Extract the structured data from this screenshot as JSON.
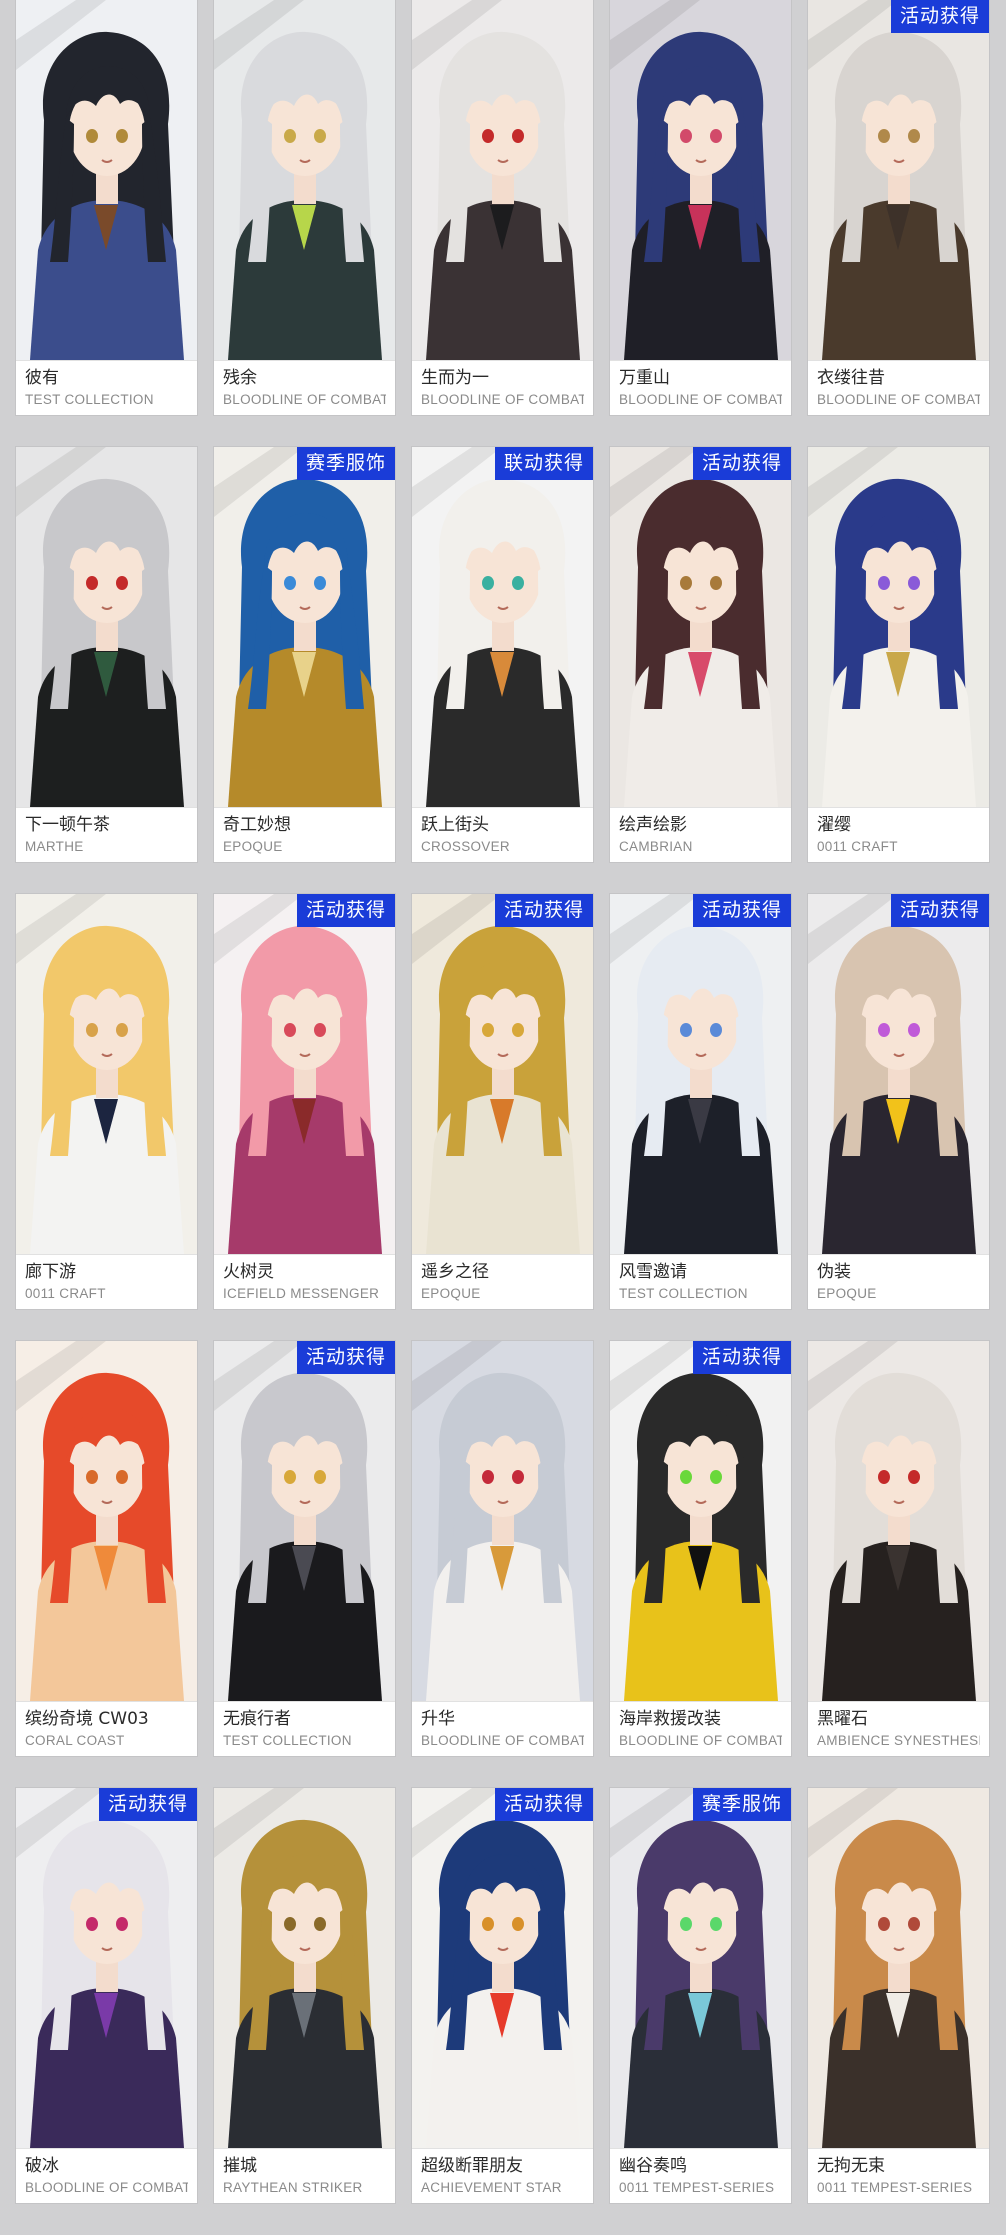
{
  "cards": [
    {
      "name": "彼有",
      "series": "TEST COLLECTION",
      "badge": "",
      "hair": "#22252d",
      "outfit": "#3b4d8c",
      "bg": "#eef0f3",
      "eyes": "#b08a3a",
      "accent": "#7a4a2a"
    },
    {
      "name": "残余",
      "series": "BLOODLINE OF COMBAT",
      "badge": "",
      "hair": "#d9dadd",
      "outfit": "#2c3a3a",
      "bg": "#e7e9ea",
      "eyes": "#c9a94a",
      "accent": "#b7d64a"
    },
    {
      "name": "生而为一",
      "series": "BLOODLINE OF COMBAT",
      "badge": "",
      "hair": "#e4e2e0",
      "outfit": "#3a3234",
      "bg": "#eceaea",
      "eyes": "#c42a2a",
      "accent": "#1c1c1e"
    },
    {
      "name": "万重山",
      "series": "BLOODLINE OF COMBAT",
      "badge": "",
      "hair": "#2d3a78",
      "outfit": "#1f1f27",
      "bg": "#d8d6dc",
      "eyes": "#d24a6a",
      "accent": "#c8325a"
    },
    {
      "name": "衣缕往昔",
      "series": "BLOODLINE OF COMBAT",
      "badge": "活动获得",
      "hair": "#d8d4d0",
      "outfit": "#4a3a2c",
      "bg": "#e9e6e2",
      "eyes": "#b0894a",
      "accent": "#3d3129"
    },
    {
      "name": "下一顿午茶",
      "series": "MARTHE",
      "badge": "",
      "hair": "#c8c8cb",
      "outfit": "#1d1f1f",
      "bg": "#e6e6e7",
      "eyes": "#c42a2a",
      "accent": "#2f5a3e"
    },
    {
      "name": "奇工妙想",
      "series": "EPOQUE",
      "badge": "赛季服饰",
      "hair": "#1f5fa8",
      "outfit": "#b58a2a",
      "bg": "#f1efea",
      "eyes": "#3a8ad8",
      "accent": "#e8d28a"
    },
    {
      "name": "跃上街头",
      "series": "CROSSOVER",
      "badge": "联动获得",
      "hair": "#f2f0ec",
      "outfit": "#2a2a2a",
      "bg": "#f3f3f3",
      "eyes": "#3ab0a0",
      "accent": "#d88a3a"
    },
    {
      "name": "绘声绘影",
      "series": "CAMBRIAN",
      "badge": "活动获得",
      "hair": "#4a2c2e",
      "outfit": "#f0ece8",
      "bg": "#ebe7e3",
      "eyes": "#a87a3a",
      "accent": "#d84a6a"
    },
    {
      "name": "濯缨",
      "series": "0011 CRAFT",
      "badge": "",
      "hair": "#2a3a8a",
      "outfit": "#f3f1ec",
      "bg": "#ecebe6",
      "eyes": "#8a5ad8",
      "accent": "#c9a84a"
    },
    {
      "name": "廊下游",
      "series": "0011 CRAFT",
      "badge": "",
      "hair": "#f2c86a",
      "outfit": "#f3f3f2",
      "bg": "#f2f0ea",
      "eyes": "#d8a24a",
      "accent": "#1c2540"
    },
    {
      "name": "火树灵",
      "series": "ICEFIELD MESSENGER",
      "badge": "活动获得",
      "hair": "#f29aa8",
      "outfit": "#a63a6a",
      "bg": "#f5f1f2",
      "eyes": "#d84a5a",
      "accent": "#8a2a2a"
    },
    {
      "name": "遥乡之径",
      "series": "EPOQUE",
      "badge": "活动获得",
      "hair": "#c9a23a",
      "outfit": "#e9e3d2",
      "bg": "#efe9dc",
      "eyes": "#d8a83a",
      "accent": "#d87a2a"
    },
    {
      "name": "风雪邀请",
      "series": "TEST COLLECTION",
      "badge": "活动获得",
      "hair": "#e6ebf2",
      "outfit": "#1d2029",
      "bg": "#eef0f2",
      "eyes": "#5a8ad8",
      "accent": "#3a3a44"
    },
    {
      "name": "伪装",
      "series": "EPOQUE",
      "badge": "活动获得",
      "hair": "#d8c4b0",
      "outfit": "#2a2630",
      "bg": "#ecebec",
      "eyes": "#c05ad8",
      "accent": "#f2c21a"
    },
    {
      "name": "缤纷奇境 CW03",
      "series": "CORAL COAST",
      "badge": "",
      "hair": "#e64a2a",
      "outfit": "#f3c79a",
      "bg": "#f6eee6",
      "eyes": "#d86a2a",
      "accent": "#ef8a3a"
    },
    {
      "name": "无痕行者",
      "series": "TEST COLLECTION",
      "badge": "活动获得",
      "hair": "#c8c8cd",
      "outfit": "#1a1a1d",
      "bg": "#ebebec",
      "eyes": "#d8a83a",
      "accent": "#4a4a52"
    },
    {
      "name": "升华",
      "series": "BLOODLINE OF COMBAT",
      "badge": "",
      "hair": "#c6cbd4",
      "outfit": "#f2f0ee",
      "bg": "#d7dae2",
      "eyes": "#c42a3a",
      "accent": "#d89a3a"
    },
    {
      "name": "海岸救援改装",
      "series": "BLOODLINE OF COMBAT",
      "badge": "活动获得",
      "hair": "#2a2a2a",
      "outfit": "#e8c21a",
      "bg": "#f2f2f2",
      "eyes": "#6ad83a",
      "accent": "#111111"
    },
    {
      "name": "黑曜石",
      "series": "AMBIENCE SYNESTHESIA",
      "badge": "",
      "hair": "#e2ddd8",
      "outfit": "#26211f",
      "bg": "#ece8e5",
      "eyes": "#c42a2a",
      "accent": "#3a3330"
    },
    {
      "name": "破冰",
      "series": "BLOODLINE OF COMBAT",
      "badge": "活动获得",
      "hair": "#e6e4ea",
      "outfit": "#3a2a5a",
      "bg": "#eeeef0",
      "eyes": "#c42a6a",
      "accent": "#7a3aa8"
    },
    {
      "name": "摧城",
      "series": "RAYTHEAN STRIKER",
      "badge": "",
      "hair": "#b5913a",
      "outfit": "#2a2d33",
      "bg": "#eceae6",
      "eyes": "#8a6a2a",
      "accent": "#6a7078"
    },
    {
      "name": "超级断罪朋友",
      "series": "ACHIEVEMENT STAR",
      "badge": "活动获得",
      "hair": "#1d3a7a",
      "outfit": "#f3f1ee",
      "bg": "#f3f2ef",
      "eyes": "#d8902a",
      "accent": "#e63a2a"
    },
    {
      "name": "幽谷奏鸣",
      "series": "0011 TEMPEST-SERIES",
      "badge": "赛季服饰",
      "hair": "#4a3a6a",
      "outfit": "#2a2e38",
      "bg": "#e9e9ec",
      "eyes": "#5ad86a",
      "accent": "#7ac8d8"
    },
    {
      "name": "无拘无束",
      "series": "0011 TEMPEST-SERIES",
      "badge": "",
      "hair": "#c98a4a",
      "outfit": "#3a302a",
      "bg": "#efe9e2",
      "eyes": "#b04a3a",
      "accent": "#f0ece6"
    }
  ]
}
